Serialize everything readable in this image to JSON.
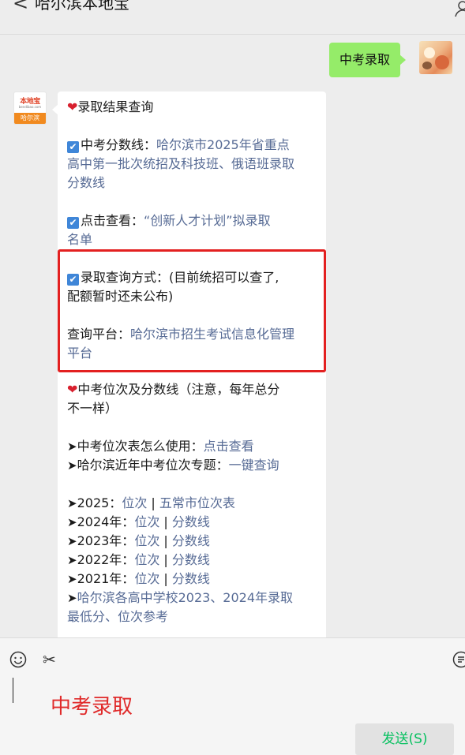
{
  "header": {
    "back_glyph": "<",
    "title": "哈尔滨本地宝"
  },
  "self_message": {
    "text": "中考录取"
  },
  "bot": {
    "logo_top": "本地宝",
    "logo_url": "bendibao.com",
    "logo_city": "哈尔滨"
  },
  "article": {
    "section1_title": "录取结果查询",
    "item1_label": "中考分数线：",
    "item1_link_l1": "哈尔滨市2025年省重点",
    "item1_link_l2": "高中第一批次统招及科技班、俄语班录取",
    "item1_link_l3": "分数线",
    "item2_label": "点击查看：",
    "item2_link_l1": "“创新人才计划”拟录取",
    "item2_link_l2": "名单",
    "item3_l1": "录取查询方式：(目前统招可以查了,",
    "item3_l2": "配额暂时还未公布)",
    "platform_label": "查询平台：",
    "platform_link_l1": "哈尔滨市招生考试信息化管理",
    "platform_link_l2": "平台",
    "section2_title_l1": "中考位次及分数线（注意，每年总分",
    "section2_title_l2": "不一样）",
    "rank_use_label": "中考位次表怎么使用：",
    "rank_use_link": "点击查看",
    "rank_topic_label": "哈尔滨近年中考位次专题：",
    "rank_topic_link": "一键查询",
    "years": [
      {
        "label": "2025：",
        "link1": "位次",
        "sep": " | ",
        "link2": "五常市位次表"
      },
      {
        "label": "2024年：",
        "link1": "位次",
        "sep": " | ",
        "link2": "分数线"
      },
      {
        "label": "2023年：",
        "link1": "位次",
        "sep": " | ",
        "link2": "分数线"
      },
      {
        "label": "2022年：",
        "link1": "位次",
        "sep": " | ",
        "link2": "分数线"
      },
      {
        "label": "2021年：",
        "link1": "位次",
        "sep": " | ",
        "link2": "分数线"
      }
    ],
    "last_link_l1": "哈尔滨各高中学校2023、2024年录取",
    "last_link_l2": "最低分、位次参考",
    "arrow": "➤",
    "heart": "❤",
    "check": "✔"
  },
  "input": {
    "text": "中考录取",
    "send_label": "发送(S)"
  },
  "colors": {
    "link": "#576b95",
    "accent_green": "#95ec69",
    "highlight_red": "#e32020"
  }
}
